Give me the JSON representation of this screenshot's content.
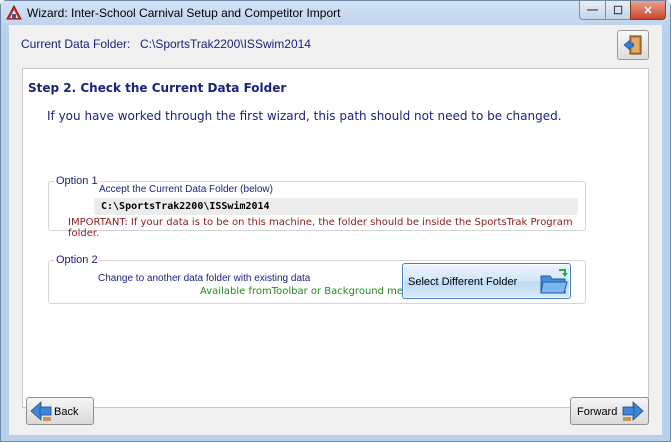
{
  "window": {
    "title": "Wizard: Inter-School Carnival Setup and Competitor Import",
    "controls": {
      "minimize": "—",
      "maximize": "☐",
      "close": "✕"
    }
  },
  "header": {
    "current_folder_label": "Current Data Folder:",
    "current_folder_path": "C:\\SportsTrak2200\\ISSwim2014",
    "exit_icon": "exit-door-icon"
  },
  "step": {
    "title": "Step 2. Check the Current Data Folder",
    "description": "If you have worked through the first wizard, this path should not need to be changed."
  },
  "option1": {
    "legend": "Option 1",
    "accept_text": "Accept the Current Data Folder (below)",
    "path": "C:\\SportsTrak2200\\ISSwim2014",
    "important": "IMPORTANT: If your data is to be on this machine, the folder should be inside the SportsTrak Program folder."
  },
  "option2": {
    "legend": "Option 2",
    "change_text": "Change to another data folder with existing data",
    "available_text": "Available fromToolbar or Background menu",
    "select_button": "Select Different Folder",
    "select_icon": "open-folder-icon"
  },
  "nav": {
    "back_label": "Back",
    "back_icon": "back-arrow-icon",
    "forward_label": "Forward",
    "forward_icon": "forward-arrow-icon"
  },
  "colors": {
    "text_blue": "#1a237e",
    "important_red": "#8b1a1a",
    "available_green": "#1f8a1f",
    "frame": "#b9d1ea"
  }
}
